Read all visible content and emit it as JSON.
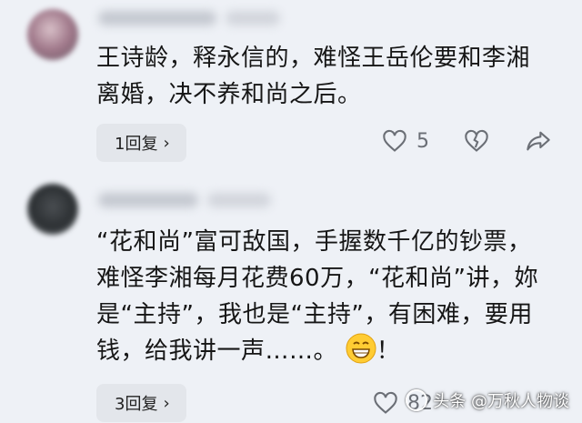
{
  "comments": [
    {
      "text": "王诗龄，释永信的，难怪王岳伦要和李湘离婚，决不养和尚之后。",
      "reply_label": "1回复",
      "like_count": "5"
    },
    {
      "text": "“花和尚”富可敌国，手握数千亿的钞票，难怪李湘每月花费60万，“花和尚”讲，妳是“主持”，我也是“主持”，有困难，要用钱，给我讲一声……。",
      "trailing_text": "！",
      "reply_label": "3回复",
      "like_count": "82"
    }
  ],
  "watermark": {
    "text": "头条 @万秋人物谈"
  },
  "colors": {
    "background": "#eef1f6",
    "icon_gray": "#6b6f76"
  }
}
